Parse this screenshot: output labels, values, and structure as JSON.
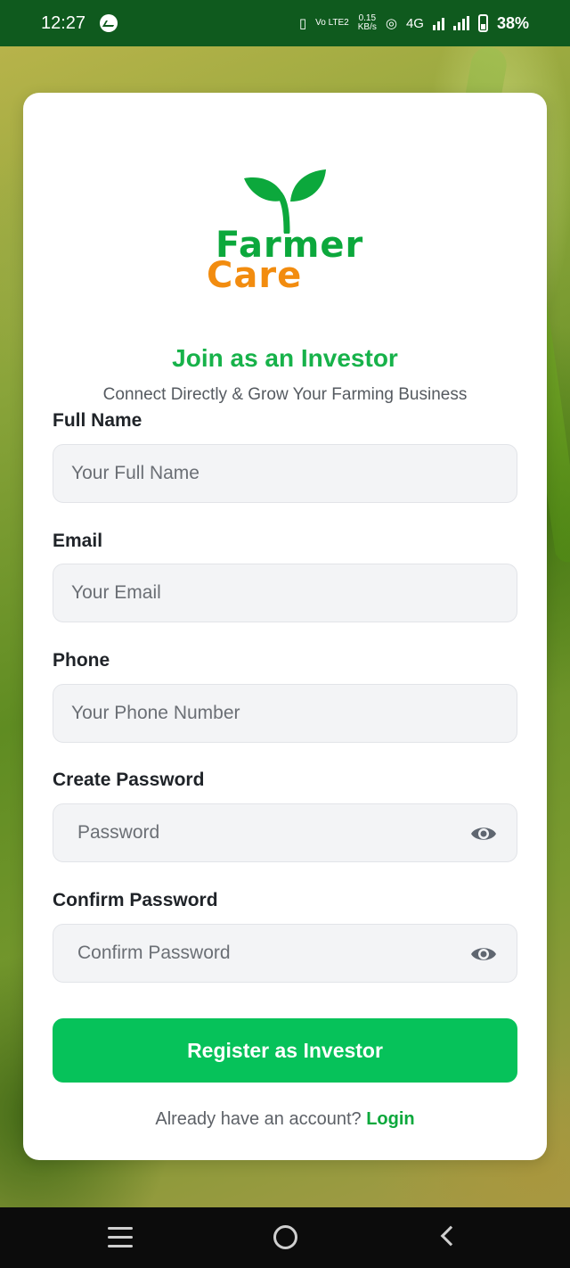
{
  "status_bar": {
    "time": "12:27",
    "volte": "Vo LTE2",
    "net_speed": "0.15",
    "net_speed_unit": "KB/s",
    "network": "4G",
    "battery": "38%"
  },
  "brand": {
    "line1": "Farmer",
    "line2": "Care",
    "green": "#0ca83c",
    "orange": "#f28c0f"
  },
  "form": {
    "title": "Join as an Investor",
    "subtitle": "Connect Directly & Grow Your Farming Business",
    "full_name": {
      "label": "Full Name",
      "placeholder": "Your Full Name"
    },
    "email": {
      "label": "Email",
      "placeholder": "Your Email"
    },
    "phone": {
      "label": "Phone",
      "placeholder": "Your Phone Number"
    },
    "password": {
      "label": "Create Password",
      "placeholder": "Password"
    },
    "confirm_password": {
      "label": "Confirm Password",
      "placeholder": "Confirm Password"
    },
    "submit_label": "Register as Investor",
    "login_prompt": "Already have an account?",
    "login_link": "Login",
    "accent": "#06c25a"
  },
  "nav": {
    "icons": [
      "menu-icon",
      "home-icon",
      "back-icon"
    ]
  }
}
